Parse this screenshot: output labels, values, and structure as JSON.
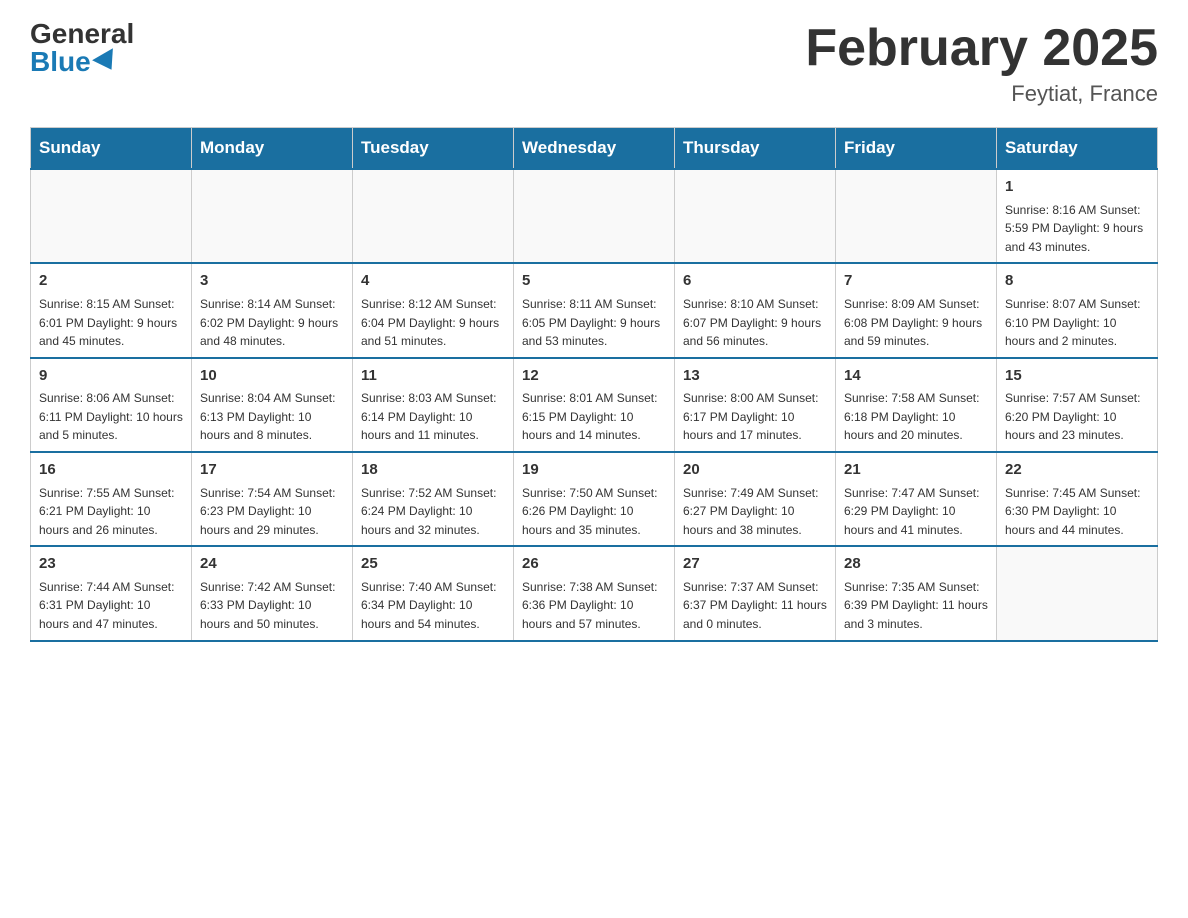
{
  "header": {
    "logo_general": "General",
    "logo_blue": "Blue",
    "month_title": "February 2025",
    "location": "Feytiat, France"
  },
  "days_of_week": [
    "Sunday",
    "Monday",
    "Tuesday",
    "Wednesday",
    "Thursday",
    "Friday",
    "Saturday"
  ],
  "weeks": [
    [
      {
        "day": "",
        "info": ""
      },
      {
        "day": "",
        "info": ""
      },
      {
        "day": "",
        "info": ""
      },
      {
        "day": "",
        "info": ""
      },
      {
        "day": "",
        "info": ""
      },
      {
        "day": "",
        "info": ""
      },
      {
        "day": "1",
        "info": "Sunrise: 8:16 AM\nSunset: 5:59 PM\nDaylight: 9 hours\nand 43 minutes."
      }
    ],
    [
      {
        "day": "2",
        "info": "Sunrise: 8:15 AM\nSunset: 6:01 PM\nDaylight: 9 hours\nand 45 minutes."
      },
      {
        "day": "3",
        "info": "Sunrise: 8:14 AM\nSunset: 6:02 PM\nDaylight: 9 hours\nand 48 minutes."
      },
      {
        "day": "4",
        "info": "Sunrise: 8:12 AM\nSunset: 6:04 PM\nDaylight: 9 hours\nand 51 minutes."
      },
      {
        "day": "5",
        "info": "Sunrise: 8:11 AM\nSunset: 6:05 PM\nDaylight: 9 hours\nand 53 minutes."
      },
      {
        "day": "6",
        "info": "Sunrise: 8:10 AM\nSunset: 6:07 PM\nDaylight: 9 hours\nand 56 minutes."
      },
      {
        "day": "7",
        "info": "Sunrise: 8:09 AM\nSunset: 6:08 PM\nDaylight: 9 hours\nand 59 minutes."
      },
      {
        "day": "8",
        "info": "Sunrise: 8:07 AM\nSunset: 6:10 PM\nDaylight: 10 hours\nand 2 minutes."
      }
    ],
    [
      {
        "day": "9",
        "info": "Sunrise: 8:06 AM\nSunset: 6:11 PM\nDaylight: 10 hours\nand 5 minutes."
      },
      {
        "day": "10",
        "info": "Sunrise: 8:04 AM\nSunset: 6:13 PM\nDaylight: 10 hours\nand 8 minutes."
      },
      {
        "day": "11",
        "info": "Sunrise: 8:03 AM\nSunset: 6:14 PM\nDaylight: 10 hours\nand 11 minutes."
      },
      {
        "day": "12",
        "info": "Sunrise: 8:01 AM\nSunset: 6:15 PM\nDaylight: 10 hours\nand 14 minutes."
      },
      {
        "day": "13",
        "info": "Sunrise: 8:00 AM\nSunset: 6:17 PM\nDaylight: 10 hours\nand 17 minutes."
      },
      {
        "day": "14",
        "info": "Sunrise: 7:58 AM\nSunset: 6:18 PM\nDaylight: 10 hours\nand 20 minutes."
      },
      {
        "day": "15",
        "info": "Sunrise: 7:57 AM\nSunset: 6:20 PM\nDaylight: 10 hours\nand 23 minutes."
      }
    ],
    [
      {
        "day": "16",
        "info": "Sunrise: 7:55 AM\nSunset: 6:21 PM\nDaylight: 10 hours\nand 26 minutes."
      },
      {
        "day": "17",
        "info": "Sunrise: 7:54 AM\nSunset: 6:23 PM\nDaylight: 10 hours\nand 29 minutes."
      },
      {
        "day": "18",
        "info": "Sunrise: 7:52 AM\nSunset: 6:24 PM\nDaylight: 10 hours\nand 32 minutes."
      },
      {
        "day": "19",
        "info": "Sunrise: 7:50 AM\nSunset: 6:26 PM\nDaylight: 10 hours\nand 35 minutes."
      },
      {
        "day": "20",
        "info": "Sunrise: 7:49 AM\nSunset: 6:27 PM\nDaylight: 10 hours\nand 38 minutes."
      },
      {
        "day": "21",
        "info": "Sunrise: 7:47 AM\nSunset: 6:29 PM\nDaylight: 10 hours\nand 41 minutes."
      },
      {
        "day": "22",
        "info": "Sunrise: 7:45 AM\nSunset: 6:30 PM\nDaylight: 10 hours\nand 44 minutes."
      }
    ],
    [
      {
        "day": "23",
        "info": "Sunrise: 7:44 AM\nSunset: 6:31 PM\nDaylight: 10 hours\nand 47 minutes."
      },
      {
        "day": "24",
        "info": "Sunrise: 7:42 AM\nSunset: 6:33 PM\nDaylight: 10 hours\nand 50 minutes."
      },
      {
        "day": "25",
        "info": "Sunrise: 7:40 AM\nSunset: 6:34 PM\nDaylight: 10 hours\nand 54 minutes."
      },
      {
        "day": "26",
        "info": "Sunrise: 7:38 AM\nSunset: 6:36 PM\nDaylight: 10 hours\nand 57 minutes."
      },
      {
        "day": "27",
        "info": "Sunrise: 7:37 AM\nSunset: 6:37 PM\nDaylight: 11 hours\nand 0 minutes."
      },
      {
        "day": "28",
        "info": "Sunrise: 7:35 AM\nSunset: 6:39 PM\nDaylight: 11 hours\nand 3 minutes."
      },
      {
        "day": "",
        "info": ""
      }
    ]
  ]
}
